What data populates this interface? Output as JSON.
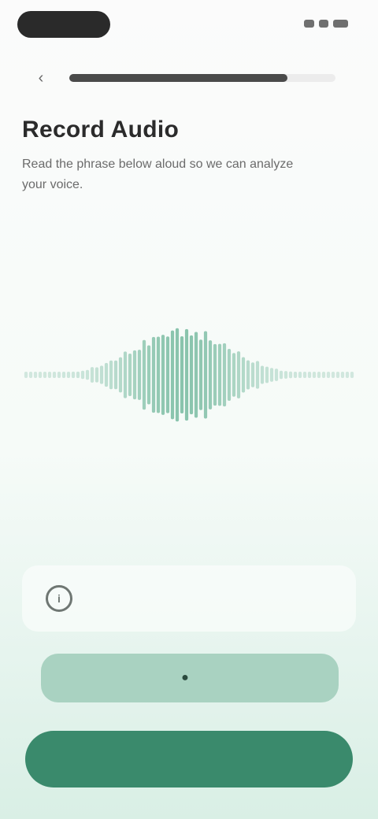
{
  "status_bar": {
    "time": "",
    "indicators": [
      "signal-icon",
      "wifi-icon",
      "battery-icon"
    ]
  },
  "header": {
    "back_icon": "chevron-left-icon",
    "progress": 0.82
  },
  "content": {
    "title": "Record Audio",
    "subtitle": "Read the phrase below aloud so we can analyze your voice.",
    "phrase": "",
    "timer": ""
  },
  "waveform": {
    "color": "#8ac4ad",
    "bar_count": 70
  },
  "option": {
    "icon": "info-circle-icon",
    "label": ""
  },
  "actions": {
    "secondary_label": "",
    "secondary_icon": "mic-icon",
    "primary_label": ""
  },
  "colors": {
    "accent": "#3a8a6c",
    "accent_light": "#a9d2c1"
  }
}
